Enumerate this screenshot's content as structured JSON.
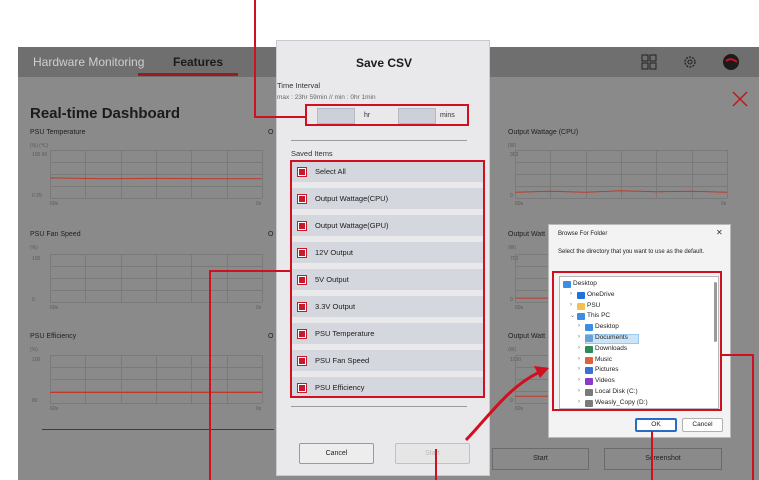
{
  "app": {
    "tabs": [
      "Hardware Monitoring",
      "Features"
    ],
    "dashboard_title": "Real-time Dashboard",
    "start_label": "Start",
    "screenshot_label": "Screenshot"
  },
  "charts": [
    {
      "label": "PSU Temperature",
      "unit_left": "(%)",
      "unit_right": "(℃)",
      "y_top": "100",
      "y_top_alt": "60",
      "y_bottom": "0",
      "y_bottom_alt": "25",
      "x_left": "60s",
      "x_right": "0s"
    },
    {
      "label": "PSU Fan Speed",
      "unit_left": "(%)",
      "y_top": "100",
      "y_bottom": "0",
      "x_left": "60s",
      "x_right": "0s"
    },
    {
      "label": "PSU Efficiency",
      "unit_left": "(%)",
      "y_top": "100",
      "y_bottom": "80",
      "x_left": "60s",
      "x_right": "0s"
    },
    {
      "label": "Output Wattage (CPU)",
      "unit_left": "(W)",
      "y_top": "300",
      "y_bottom": "0",
      "x_left": "60s",
      "x_right": "0s"
    },
    {
      "label": "Output Watt",
      "unit_left": "(W)",
      "y_top": "700",
      "y_bottom": "0",
      "x_left": "60s",
      "x_right": "0s"
    },
    {
      "label": "Output Watt",
      "unit_left": "(W)",
      "y_top": "1000",
      "y_bottom": "0",
      "x_left": "60s",
      "x_right": "0s"
    }
  ],
  "middle_chart_labels": [
    "O",
    "O",
    "O"
  ],
  "save_csv": {
    "title": "Save CSV",
    "time_interval_label": "Time Interval",
    "time_interval_hint": "max : 23hr 59min // min : 0hr 1min",
    "hours_value": "",
    "hours_unit": "hr",
    "minutes_value": "",
    "minutes_unit": "mins",
    "saved_items_label": "Saved Items",
    "items": [
      {
        "label": "Select All",
        "checked": true
      },
      {
        "label": "Output Wattage(CPU)",
        "checked": true
      },
      {
        "label": "Output Wattage(GPU)",
        "checked": true
      },
      {
        "label": "12V Output",
        "checked": true
      },
      {
        "label": "5V Output",
        "checked": true
      },
      {
        "label": "3.3V Output",
        "checked": true
      },
      {
        "label": "PSU Temperature",
        "checked": true
      },
      {
        "label": "PSU Fan Speed",
        "checked": true
      },
      {
        "label": "PSU Efficiency",
        "checked": true
      }
    ],
    "cancel_label": "Cancel",
    "start_label": "Start"
  },
  "browse_folder": {
    "title": "Browse For Folder",
    "close_glyph": "✕",
    "description": "Select the directory that you want to use as the default.",
    "tree": [
      {
        "label": "Desktop",
        "level": 0,
        "chevron": "",
        "icon_color": "#3a8ee6"
      },
      {
        "label": "OneDrive",
        "level": 1,
        "chevron": ">",
        "icon_color": "#1e73d6"
      },
      {
        "label": "PSU",
        "level": 1,
        "chevron": ">",
        "icon_color": "#f2c14e"
      },
      {
        "label": "This PC",
        "level": 1,
        "chevron": "v",
        "icon_color": "#3a8ee6"
      },
      {
        "label": "Desktop",
        "level": 2,
        "chevron": ">",
        "icon_color": "#3a8ee6"
      },
      {
        "label": "Documents",
        "level": 2,
        "chevron": ">",
        "icon_color": "#6aa0d8",
        "selected": true
      },
      {
        "label": "Downloads",
        "level": 2,
        "chevron": ">",
        "icon_color": "#2e8b57"
      },
      {
        "label": "Music",
        "level": 2,
        "chevron": ">",
        "icon_color": "#e0603a"
      },
      {
        "label": "Pictures",
        "level": 2,
        "chevron": ">",
        "icon_color": "#3a6fd6"
      },
      {
        "label": "Videos",
        "level": 2,
        "chevron": ">",
        "icon_color": "#8a3ac8"
      },
      {
        "label": "Local Disk (C:)",
        "level": 2,
        "chevron": ">",
        "icon_color": "#7a7a7a"
      },
      {
        "label": "Weasly_Copy (D:)",
        "level": 2,
        "chevron": ">",
        "icon_color": "#7a7a7a"
      }
    ],
    "ok_label": "OK",
    "cancel_label": "Cancel"
  },
  "colors": {
    "accent": "#d01020",
    "checkbox": "#c5192d",
    "chart_line": "#c0392b"
  }
}
